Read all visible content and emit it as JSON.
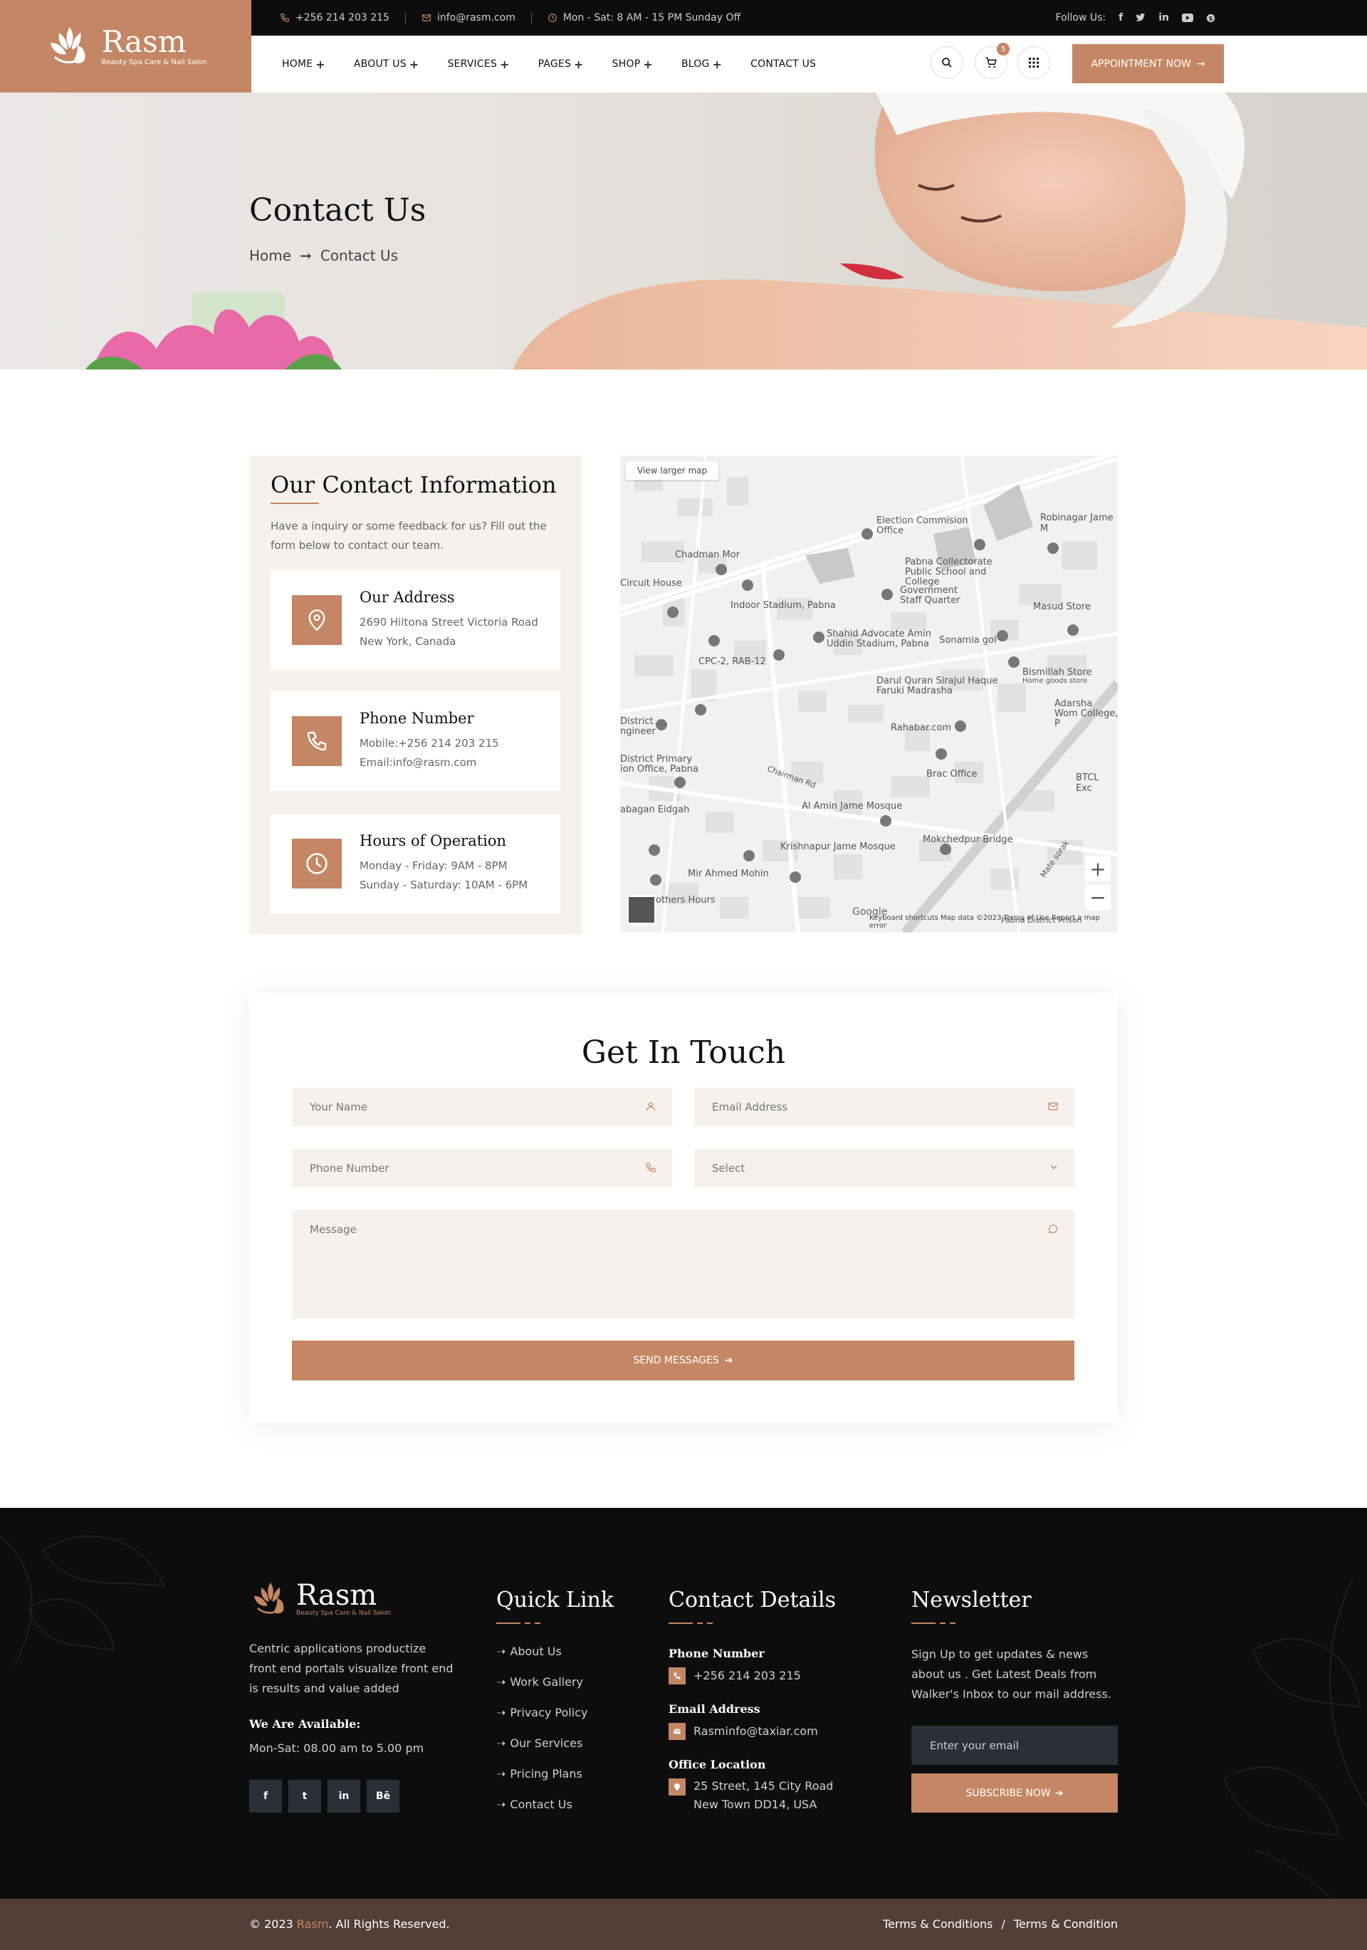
{
  "brand": {
    "name": "Rasm",
    "tagline": "Beauty Spa Care & Nail Salon",
    "accent": "#c48664"
  },
  "topbar": {
    "phone": "+256 214 203 215",
    "email": "info@rasm.com",
    "hours": "Mon - Sat: 8 AM - 15 PM Sunday Off",
    "follow_label": "Follow Us:",
    "socials": [
      "facebook-icon",
      "twitter-icon",
      "linkedin-icon",
      "youtube-icon",
      "skype-icon"
    ]
  },
  "nav": {
    "items": [
      "HOME",
      "ABOUT US",
      "SERVICES",
      "PAGES",
      "SHOP",
      "BLOG",
      "CONTACT US"
    ],
    "cart_count": "5",
    "appointment_label": "APPOINTMENT NOW"
  },
  "hero": {
    "title": "Contact Us",
    "crumb_home": "Home",
    "crumb_current": "Contact Us"
  },
  "contact_info": {
    "title": "Our Contact Information",
    "desc": "Have a inquiry or some feedback for us? Fill out the form below to contact our team.",
    "address": {
      "heading": "Our Address",
      "line1": "2690 Hiltona Street Victoria Road",
      "line2": "New York, Canada"
    },
    "phone": {
      "heading": "Phone Number",
      "line1": "Mobile:+256 214 203 215",
      "line2": "Email:info@rasm.com"
    },
    "hours": {
      "heading": "Hours of Operation",
      "line1": "Monday - Friday: 9AM - 8PM",
      "line2": "Sunday - Saturday: 10AM - 6PM"
    }
  },
  "map": {
    "view_larger": "View larger map",
    "labels": [
      "Election Commision Office",
      "Chadman Mor",
      "Pabna Collectorate Public School and College",
      "Robinagar Jame M",
      "Circuit House",
      "Indoor Stadium, Pabna",
      "Government Staff Quarter",
      "Masud Store",
      "Shahid Advocate Amin Uddin Stadium, Pabna",
      "Sonamia gol",
      "CPC-2, RAB-12",
      "Darul Quran Sirajul Haque Faruki Madrasha",
      "Bismillah Store",
      "Home goods store",
      "Adarsha Wom College, P",
      "District ngineer",
      "Rahabar.com",
      "District Primary ion Office, Pabna",
      "Brac Office",
      "BTCL Exc",
      "Chairman Rd",
      "abagan Eidgah",
      "Al Amin Jame Mosque",
      "Krishnapur Jame Mosque",
      "Mokchedpur Bridge",
      "Mir Ahmed Mohin",
      "others Hours",
      "Pabna District Prison",
      "Mate sorak"
    ],
    "footer": "Keyboard shortcuts   Map data ©2023   Terms of Use   Report a map error",
    "google": "Google"
  },
  "form": {
    "title": "Get In Touch",
    "name_placeholder": "Your Name",
    "email_placeholder": "Email Address",
    "phone_placeholder": "Phone Number",
    "select_value": "Select",
    "message_placeholder": "Message",
    "send_label": "SEND MESSAGES"
  },
  "footer": {
    "about": "Centric applications productize front end portals visualize front end is results and value added",
    "available_title": "We Are Available:",
    "available_hours": "Mon-Sat: 08.00 am to 5.00 pm",
    "socials": [
      "f",
      "t",
      "in",
      "Bē"
    ],
    "quick_title": "Quick Link",
    "quick_links": [
      "About Us",
      "Work Gallery",
      "Privacy Policy",
      "Our Services",
      "Pricing Plans",
      "Contact Us"
    ],
    "contact_title": "Contact Details",
    "phone_title": "Phone Number",
    "phone_value": "+256 214 203 215",
    "email_title": "Email Address",
    "email_value": "Rasminfo@taxiar.com",
    "office_title": "Office Location",
    "office_value": "25 Street, 145 City Road New Town DD14, USA",
    "news_title": "Newsletter",
    "news_desc": "Sign Up to get updates & news about us . Get Latest Deals from Walker's Inbox to our mail address.",
    "news_placeholder": "Enter your email",
    "news_btn": "SUBSCRIBE NOW"
  },
  "bottom": {
    "copy_prefix": "© 2023",
    "copy_brand": "Rasm",
    "copy_suffix": ". All Rights Reserved.",
    "terms1": "Terms & Conditions",
    "sep": "/",
    "terms2": "Terms & Condition"
  }
}
